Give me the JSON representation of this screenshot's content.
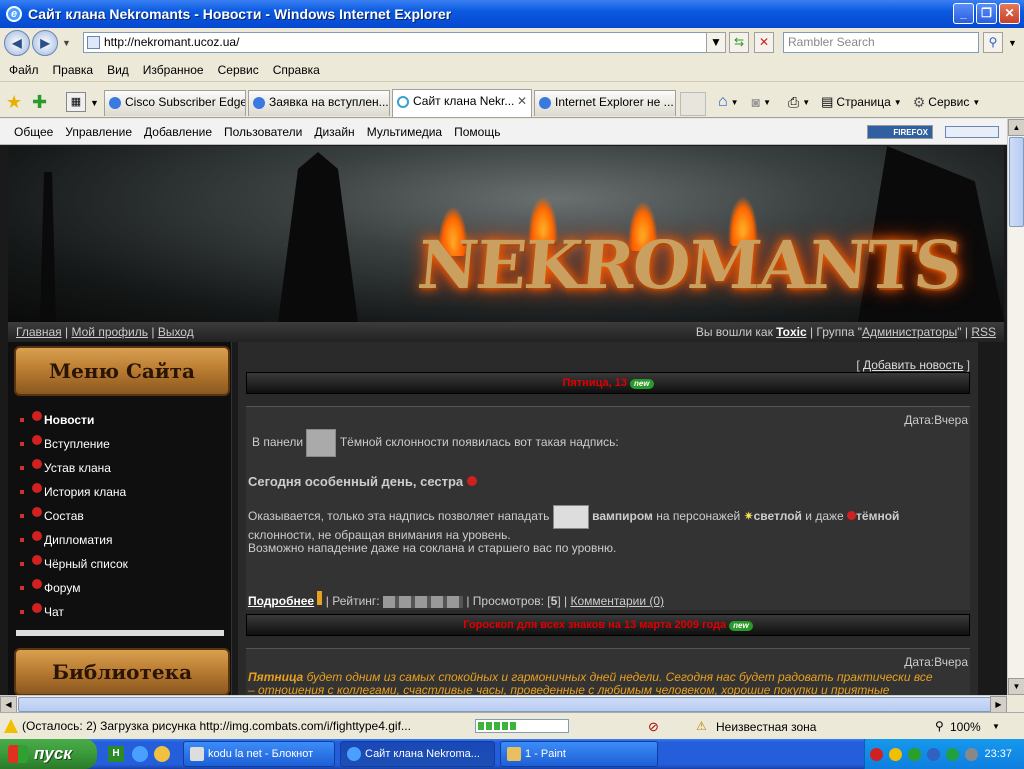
{
  "window": {
    "title": "Сайт клана Nekromants - Новости - Windows Internet Explorer"
  },
  "address": {
    "url": "http://nekromant.ucoz.ua/",
    "search_placeholder": "Rambler Search"
  },
  "menubar": [
    "Файл",
    "Правка",
    "Вид",
    "Избранное",
    "Сервис",
    "Справка"
  ],
  "tabs": [
    {
      "label": "Cisco Subscriber Edge..."
    },
    {
      "label": "Заявка на вступлен..."
    },
    {
      "label": "Сайт клана Nekr..."
    },
    {
      "label": "Internet Explorer не ..."
    }
  ],
  "toolbar_right": {
    "page_label": "Страница",
    "service_label": "Сервис"
  },
  "ucoz_menu": [
    "Общее",
    "Управление",
    "Добавление",
    "Пользователи",
    "Дизайн",
    "Мультимедиа",
    "Помощь"
  ],
  "firefox_badge": "FIREFOX",
  "banner": {
    "logo_text": "NEKROMANTS"
  },
  "userbar": {
    "home": "Главная",
    "profile": "Мой профиль",
    "logout": "Выход",
    "logged_as": "Вы вошли как",
    "username": "Toxic",
    "group_prefix": "| Группа \"",
    "group": "Администраторы",
    "group_suffix": "\" |",
    "rss": "RSS"
  },
  "sidebar": {
    "menu_title": "Меню Сайта",
    "items": [
      "Новости",
      "Вступление",
      "Устав клана",
      "История клана",
      "Состав",
      "Дипломатия",
      "Чёрный список",
      "Форум",
      "Чат"
    ],
    "library_title": "Библиотека"
  },
  "main": {
    "add_news": "Добавить новость",
    "news1": {
      "header": "Пятница, 13",
      "badge": "new",
      "date": "Дата:Вчера",
      "line1_a": "В панели",
      "line1_b": "Тёмной склонности появилась вот такая надпись:",
      "heading": "Сегодня особенный день, сестра",
      "line3_a": "Оказывается, только эта надпись позволяет нападать",
      "vampire": "вампиром",
      "line3_b": "на персонажей",
      "light": "светлой",
      "line3_c": "и даже",
      "dark": "тёмной",
      "line4": "склонности, не обращая внимания на уровень.",
      "line5": "Возможно нападение даже на соклана и старшего вас по уровню.",
      "more": "Подробнее",
      "rating_label": "| Рейтинг:",
      "views_label": "| Просмотров: [",
      "views": "5",
      "views_close": "] |",
      "comments": "Комментарии (0)"
    },
    "news2": {
      "header": "Гороскоп для всех знаков на 13 марта 2009 года",
      "badge": "new",
      "date": "Дата:Вчера",
      "lead": "Пятница",
      "text": "будет одним из самых спокойных и гармоничных дней недели. Сегодня нас будет радовать практически все",
      "text2": "– отношения с коллегами, счастливые часы, проведенные с любимым человеком, хорошие покупки и приятные"
    }
  },
  "statusbar": {
    "text": "(Осталось: 2) Загрузка рисунка http://img.combats.com/i/fighttype4.gif...",
    "zone": "Неизвестная зона",
    "zoom": "100%"
  },
  "taskbar": {
    "start": "пуск",
    "buttons": [
      "kodu la net - Блокнот",
      "Сайт клана Nekroma...",
      "1 - Paint"
    ],
    "clock": "23:37"
  },
  "colors": {
    "titlebar": "#0a5ae0",
    "news_header_text": "#e00000",
    "horoscope_text": "#e8a020"
  }
}
